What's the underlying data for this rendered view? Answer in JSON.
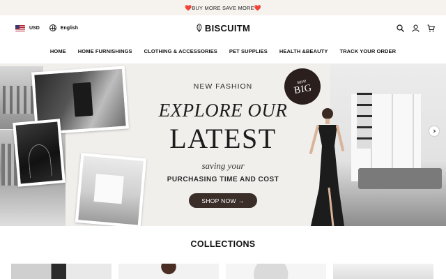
{
  "announcement": {
    "text": "BUY MORE SAVE MORE",
    "heart": "❤️"
  },
  "header": {
    "currency": "USD",
    "language": "English",
    "brand": "BISCUITM",
    "icons": [
      "search-icon",
      "account-icon",
      "cart-icon"
    ]
  },
  "nav": {
    "items": [
      {
        "label": "HOME"
      },
      {
        "label": "HOME FURNISHINGS"
      },
      {
        "label": "CLOTHING & ACCESSORIES"
      },
      {
        "label": "PET SUPPLIES"
      },
      {
        "label": "HEALTH &BEAUTY"
      },
      {
        "label": "TRACK YOUR ORDER"
      }
    ]
  },
  "hero": {
    "kicker": "NEW FASHION",
    "headline_1": "EXPLORE OUR",
    "headline_2": "LATEST",
    "subline": "saving your",
    "tagline": "PURCHASING TIME AND COST",
    "cta": "SHOP NOW",
    "cta_arrow": "→",
    "badge_top": "save",
    "badge_bottom": "BIG"
  },
  "collections": {
    "title": "COLLECTIONS"
  },
  "colors": {
    "accent": "#3b2e29",
    "announce_bg": "#f6f3ee",
    "heart": "#d83b3b"
  }
}
